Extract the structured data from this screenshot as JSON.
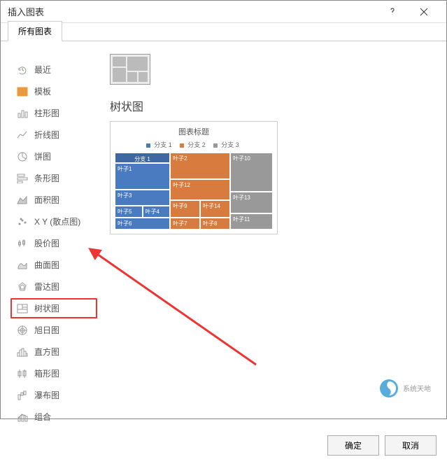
{
  "dialog": {
    "title": "插入图表",
    "tab": "所有图表"
  },
  "sidebar": {
    "items": [
      {
        "label": "最近"
      },
      {
        "label": "模板"
      },
      {
        "label": "柱形图"
      },
      {
        "label": "折线图"
      },
      {
        "label": "饼图"
      },
      {
        "label": "条形图"
      },
      {
        "label": "面积图"
      },
      {
        "label": "X Y (散点图)"
      },
      {
        "label": "股价图"
      },
      {
        "label": "曲面图"
      },
      {
        "label": "雷达图"
      },
      {
        "label": "树状图"
      },
      {
        "label": "旭日图"
      },
      {
        "label": "直方图"
      },
      {
        "label": "箱形图"
      },
      {
        "label": "瀑布图"
      },
      {
        "label": "组合"
      }
    ],
    "selected_index": 11
  },
  "main": {
    "chart_name": "树状图"
  },
  "preview": {
    "title": "图表标题",
    "legend": [
      "分支 1",
      "分支 2",
      "分支 3"
    ],
    "cells": {
      "g1_header": "分支 1",
      "g1_a": "叶子1",
      "g1_b": "叶子3",
      "g1_c": "叶子4",
      "g1_d": "叶子5",
      "g1_e": "叶子6",
      "g2_a": "叶子2",
      "g2_b": "叶子12",
      "g2_c": "叶子14",
      "g2_d": "叶子9",
      "g2_e": "叶子8",
      "g2_f": "叶子7",
      "g3_a": "叶子10",
      "g3_b": "叶子13",
      "g3_c": "叶子11"
    }
  },
  "buttons": {
    "ok": "确定",
    "cancel": "取消"
  },
  "watermark": {
    "text": "系统天地"
  },
  "chart_data": {
    "type": "treemap",
    "title": "图表标题",
    "groups": [
      {
        "name": "分支 1",
        "color": "#4a7ac0",
        "leaves": [
          "叶子1",
          "叶子3",
          "叶子4",
          "叶子5",
          "叶子6"
        ]
      },
      {
        "name": "分支 2",
        "color": "#d87b3e",
        "leaves": [
          "叶子2",
          "叶子12",
          "叶子14",
          "叶子9",
          "叶子8",
          "叶子7"
        ]
      },
      {
        "name": "分支 3",
        "color": "#999999",
        "leaves": [
          "叶子10",
          "叶子13",
          "叶子11"
        ]
      }
    ]
  }
}
